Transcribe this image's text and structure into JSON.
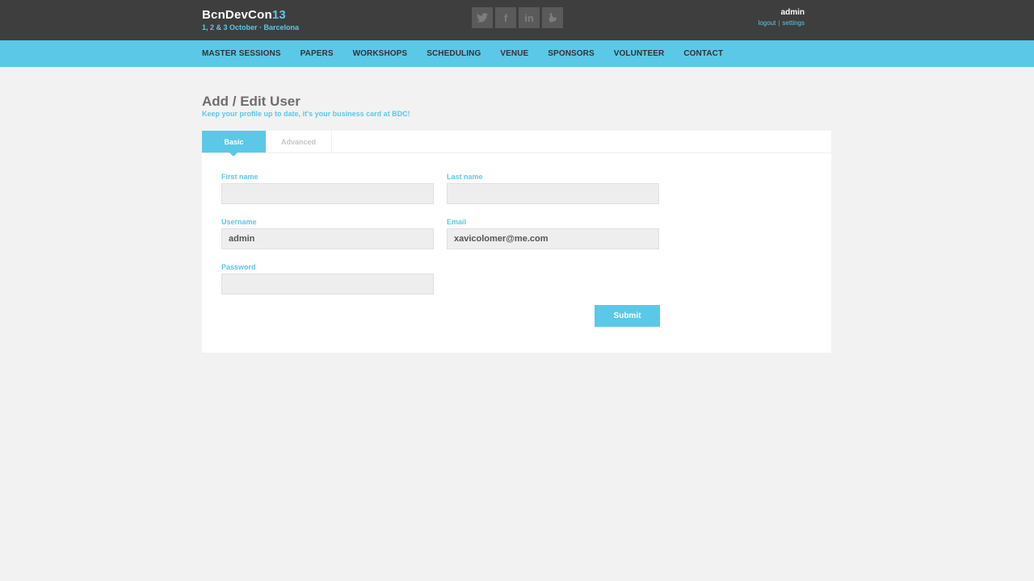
{
  "header": {
    "brand_name": "BcnDevCon",
    "brand_year": "13",
    "brand_subtitle": "1, 2 & 3 October · Barcelona",
    "social": [
      {
        "icon": "twitter-icon"
      },
      {
        "icon": "facebook-icon",
        "glyph": "f"
      },
      {
        "icon": "linkedin-icon",
        "glyph": "in"
      },
      {
        "icon": "bird-icon"
      }
    ],
    "user": {
      "name": "admin",
      "logout_label": "logout",
      "separator": "|",
      "settings_label": "settings"
    }
  },
  "nav": {
    "items": [
      "MASTER SESSIONS",
      "PAPERS",
      "WORKSHOPS",
      "SCHEDULING",
      "VENUE",
      "SPONSORS",
      "VOLUNTEER",
      "CONTACT"
    ]
  },
  "page": {
    "title": "Add / Edit User",
    "subtitle": "Keep your profile up to date, it's your business card at BDC!"
  },
  "form": {
    "tabs": {
      "basic": "Basic",
      "advanced": "Advanced"
    },
    "active_tab": "basic",
    "first_name": {
      "label": "First name",
      "value": ""
    },
    "last_name": {
      "label": "Last name",
      "value": ""
    },
    "username": {
      "label": "Username",
      "value": "admin"
    },
    "email": {
      "label": "Email",
      "value": "xavicolomer@me.com"
    },
    "password": {
      "label": "Password",
      "value": ""
    },
    "submit_label": "Submit"
  },
  "colors": {
    "accent": "#5bc8e8",
    "header_bg": "#3e3e3e",
    "page_bg": "#f2f2f2"
  }
}
